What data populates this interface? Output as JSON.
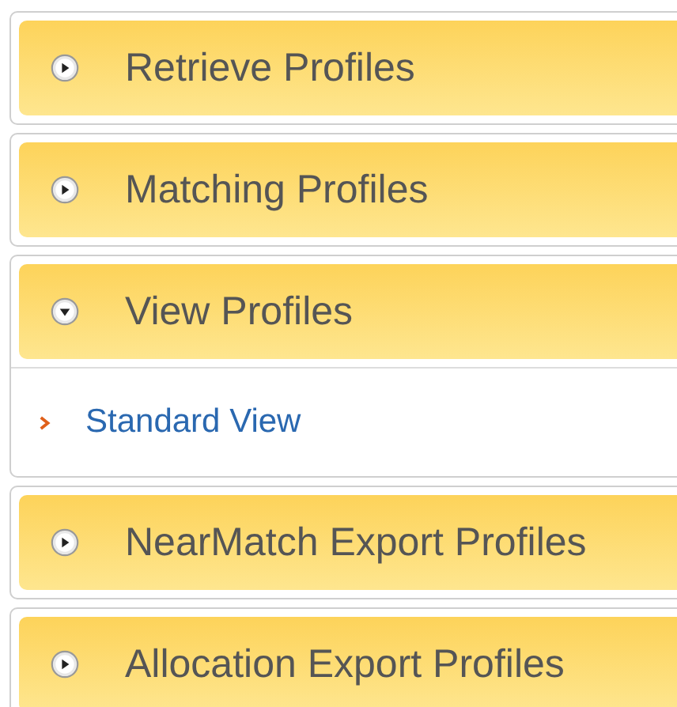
{
  "sections": [
    {
      "title": "Retrieve Profiles",
      "expanded": false
    },
    {
      "title": "Matching Profiles",
      "expanded": false
    },
    {
      "title": "View Profiles",
      "expanded": true,
      "items": [
        {
          "label": "Standard View"
        }
      ]
    },
    {
      "title": "NearMatch Export Profiles",
      "expanded": false
    },
    {
      "title": "Allocation Export Profiles",
      "expanded": false
    }
  ]
}
